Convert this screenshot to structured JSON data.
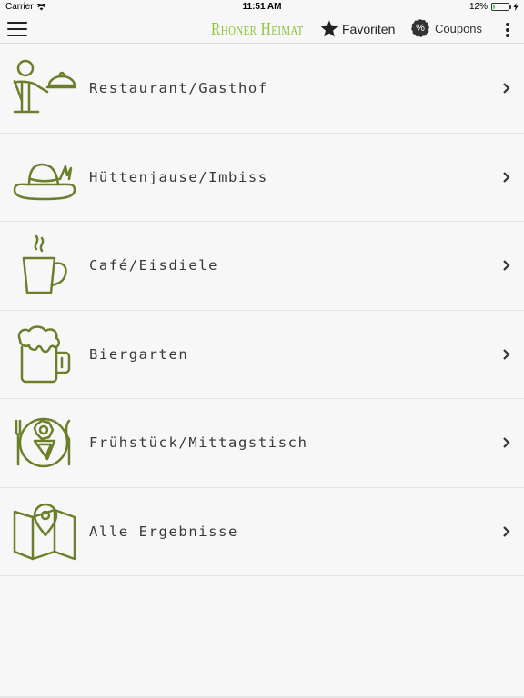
{
  "status_bar": {
    "carrier": "Carrier",
    "time": "11:51 AM",
    "battery": "12%",
    "battery_level": 0.12
  },
  "nav": {
    "brand": "Rhöner Heimat",
    "favorites_label": "Favoriten",
    "coupons_label": "Coupons",
    "coupon_symbol": "%"
  },
  "categories": [
    {
      "label": "Restaurant/Gasthof",
      "icon": "waiter-icon"
    },
    {
      "label": "Hüttenjause/Imbiss",
      "icon": "hat-icon"
    },
    {
      "label": "Café/Eisdiele",
      "icon": "coffee-cup-icon"
    },
    {
      "label": "Biergarten",
      "icon": "beer-mug-icon"
    },
    {
      "label": "Frühstück/Mittagstisch",
      "icon": "breakfast-plate-icon"
    },
    {
      "label": "Alle Ergebnisse",
      "icon": "map-pin-icon"
    }
  ],
  "colors": {
    "accent": "#8cc63f",
    "icon": "#6b7f2a",
    "text": "#3a3a3a",
    "background": "#f7f7f7"
  }
}
